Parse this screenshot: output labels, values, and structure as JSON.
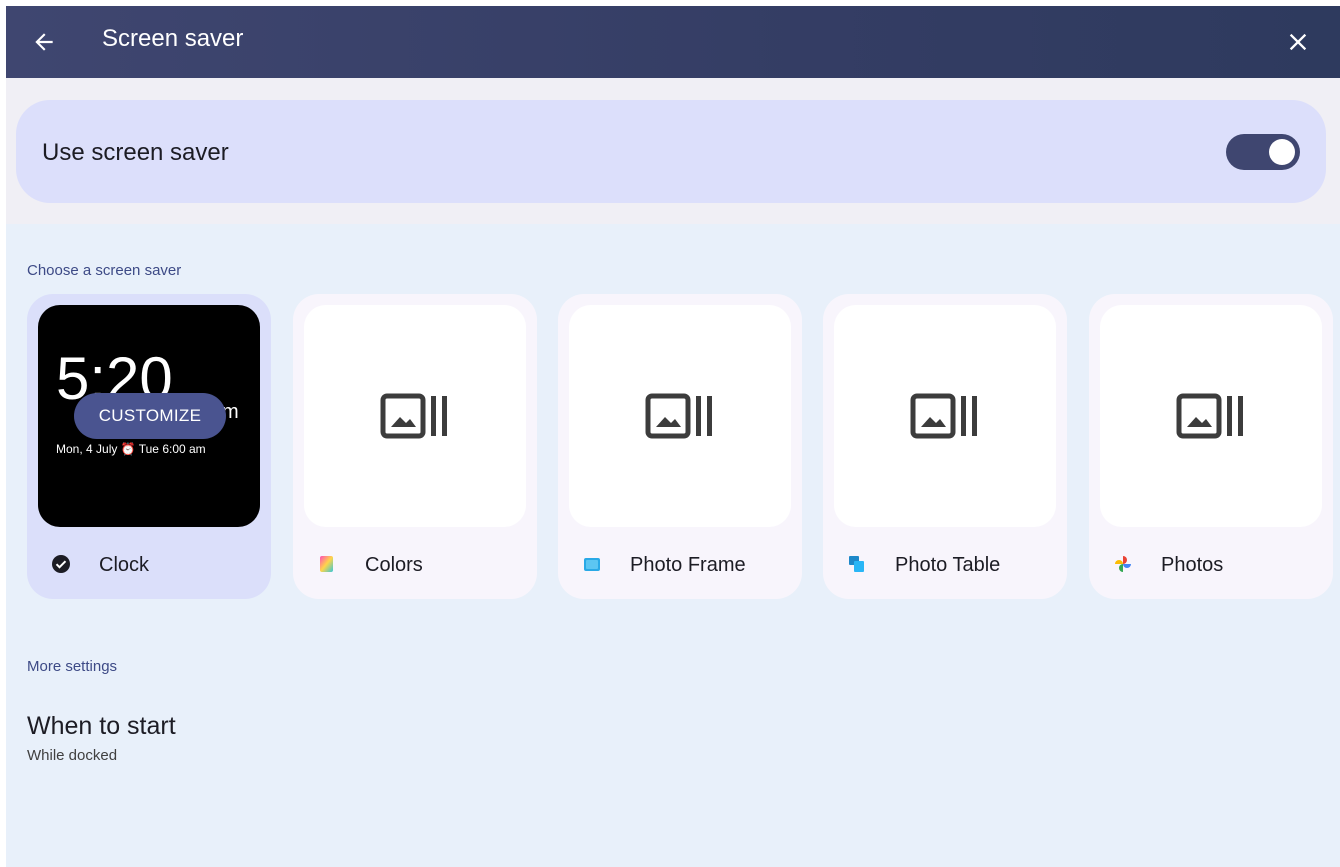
{
  "header": {
    "title": "Screen saver",
    "back_icon": "arrow-left-icon",
    "close_icon": "close-icon"
  },
  "toggle": {
    "label": "Use screen saver",
    "enabled": true
  },
  "colors": {
    "header_bg": "#343d64",
    "accent": "#3f4670",
    "toggle_card": "#dcdffb",
    "section_text": "#3d4a86",
    "page_bg": "#e8f0fa"
  },
  "choose_section": {
    "header": "Choose a screen saver",
    "options": [
      {
        "label": "Clock",
        "selected": true,
        "icon": "check-circle-icon",
        "preview": {
          "time": "5:20",
          "ampm": "m",
          "date": "Mon, 4 July ⏰ Tue 6:00 am",
          "customize": "CUSTOMIZE"
        }
      },
      {
        "label": "Colors",
        "selected": false,
        "icon": "colors-app-icon",
        "preview_icon": "image-placeholder-icon"
      },
      {
        "label": "Photo Frame",
        "selected": false,
        "icon": "photo-frame-app-icon",
        "preview_icon": "image-placeholder-icon"
      },
      {
        "label": "Photo Table",
        "selected": false,
        "icon": "photo-table-app-icon",
        "preview_icon": "image-placeholder-icon"
      },
      {
        "label": "Photos",
        "selected": false,
        "icon": "google-photos-icon",
        "preview_icon": "image-placeholder-icon"
      }
    ]
  },
  "more_section": {
    "header": "More settings",
    "items": [
      {
        "title": "When to start",
        "subtitle": "While docked"
      }
    ]
  }
}
